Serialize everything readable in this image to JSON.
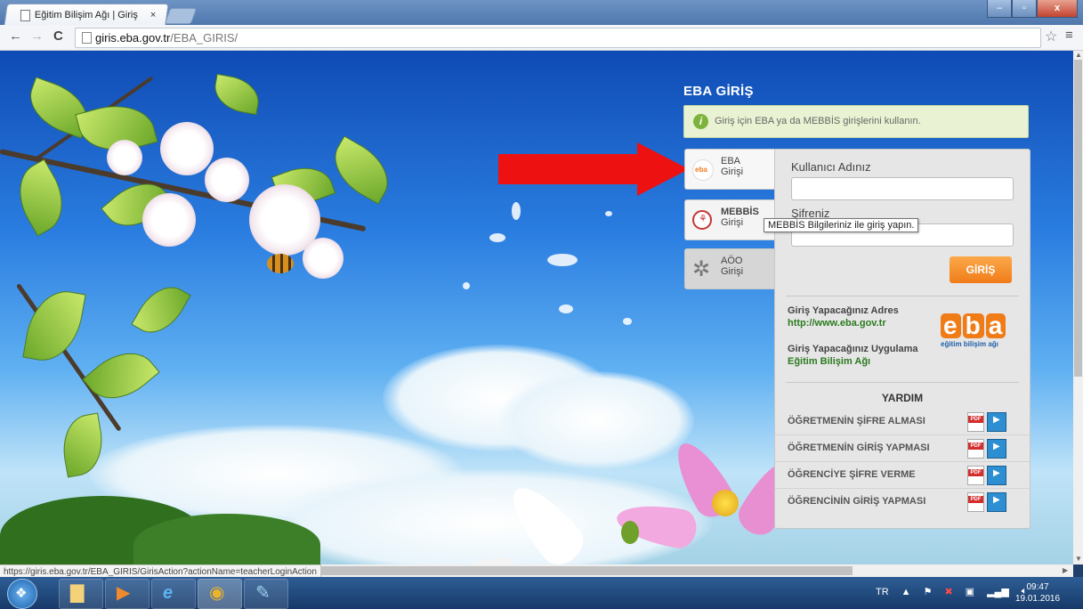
{
  "browser": {
    "tab_title": "Eğitim Bilişim Ağı | Giriş",
    "tab_close": "×",
    "url_domain": "giris.eba.gov.tr",
    "url_path": "/EBA_GIRIS/",
    "back_icon": "←",
    "forward_icon": "→",
    "reload_icon": "C",
    "star_icon": "☆",
    "menu_icon": "≡",
    "window_controls": {
      "minimize": "–",
      "maximize": "▫",
      "close": "x"
    }
  },
  "page": {
    "title": "EBA GİRİŞ",
    "info_text": "Giriş için EBA ya da MEBBİS girişlerini kullanın.",
    "side_tabs": [
      {
        "line1": "EBA",
        "line2": "Girişi",
        "icon": "eba-icon"
      },
      {
        "line1": "MEBBİS",
        "line2": "Girişi",
        "icon": "mebbis-icon"
      },
      {
        "line1": "AÖO",
        "line2": "Girişi",
        "icon": "aoo-icon"
      }
    ],
    "username_label": "Kullanıcı Adınız",
    "password_label": "Şifreniz",
    "login_button": "GİRİŞ",
    "address_label": "Giriş Yapacağınız Adres",
    "address_url": "http://www.eba.gov.tr",
    "app_label": "Giriş Yapacağınız Uygulama",
    "app_name": "Eğitim Bilişim Ağı",
    "logo": {
      "letters": [
        "e",
        "b",
        "a"
      ],
      "subtitle": "eğitim bilişim ağı"
    },
    "help_title": "YARDIM",
    "help_items": [
      "ÖĞRETMENİN ŞİFRE ALMASI",
      "ÖĞRETMENİN GİRİŞ YAPMASI",
      "ÖĞRENCİYE ŞİFRE VERME",
      "ÖĞRENCİNİN GİRİŞ YAPMASI"
    ],
    "pdf_label": "PDF",
    "tooltip": "MEBBİS Bilgileriniz ile giriş yapın."
  },
  "status_url": "https://giris.eba.gov.tr/EBA_GIRIS/GirisAction?actionName=teacherLoginAction",
  "taskbar": {
    "language": "TR",
    "time": "09:47",
    "date": "19.01.2016"
  },
  "colors": {
    "accent_orange": "#f07c18",
    "link_green": "#2b7a1e",
    "arrow_red": "#ee1111"
  }
}
